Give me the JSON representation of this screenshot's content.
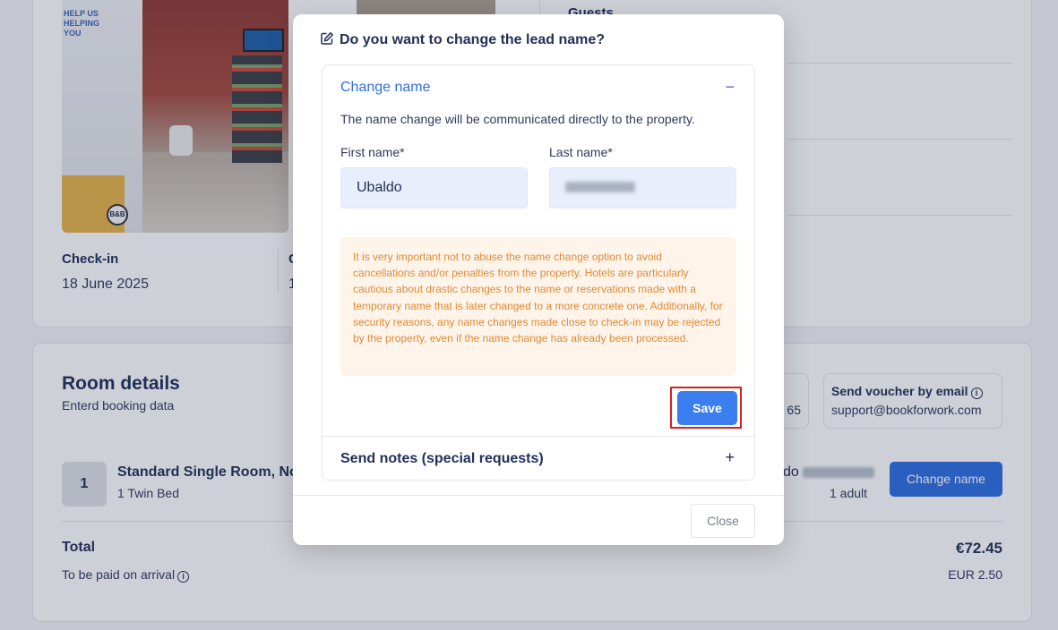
{
  "background": {
    "photo_sign": "HELP US HELPING YOU",
    "photo_logo": "B&B",
    "guests_label": "Guests",
    "checkin": {
      "label": "Check-in",
      "date": "18 June 2025"
    },
    "checkout": {
      "label": "C",
      "date": "1"
    },
    "room_details": {
      "title": "Room details",
      "subtitle": "Enterd booking data",
      "partial_box_text": "65",
      "voucher_title": "Send voucher by email",
      "voucher_email": "support@bookforwork.com",
      "room_number": "1",
      "room_name": "Standard Single Room, No",
      "room_bed": "1 Twin Bed",
      "guest_prefix": "do",
      "guest_adults": "1 adult",
      "change_name_button": "Change name"
    },
    "total": {
      "label": "Total",
      "value": "€72.45",
      "arrival_label": "To be paid on arrival",
      "arrival_value": "EUR 2.50"
    }
  },
  "modal": {
    "title": "Do you want to change the lead name?",
    "change_name": {
      "heading": "Change name",
      "collapse_symbol": "−",
      "description": "The name change will be communicated directly to the property.",
      "first_name_label": "First name*",
      "first_name_value": "Ubaldo",
      "last_name_label": "Last name*",
      "warning": "It is very important not to abuse the name change option to avoid cancellations and/or penalties from the property. Hotels are particularly cautious about drastic changes to the name or reservations made with a temporary name that is later changed to a more concrete one. Additionally, for security reasons, any name changes made close to check-in may be rejected by the property, even if the name change has already been processed.",
      "save_button": "Save"
    },
    "notes": {
      "heading": "Send notes (special requests)",
      "expand_symbol": "+"
    },
    "close_button": "Close"
  },
  "colors": {
    "accent": "#2f6fe0",
    "save": "#3a7ef0",
    "warning_text": "#e08a36",
    "warning_bg": "#fff4ea",
    "highlight_outline": "#d81f1f"
  }
}
